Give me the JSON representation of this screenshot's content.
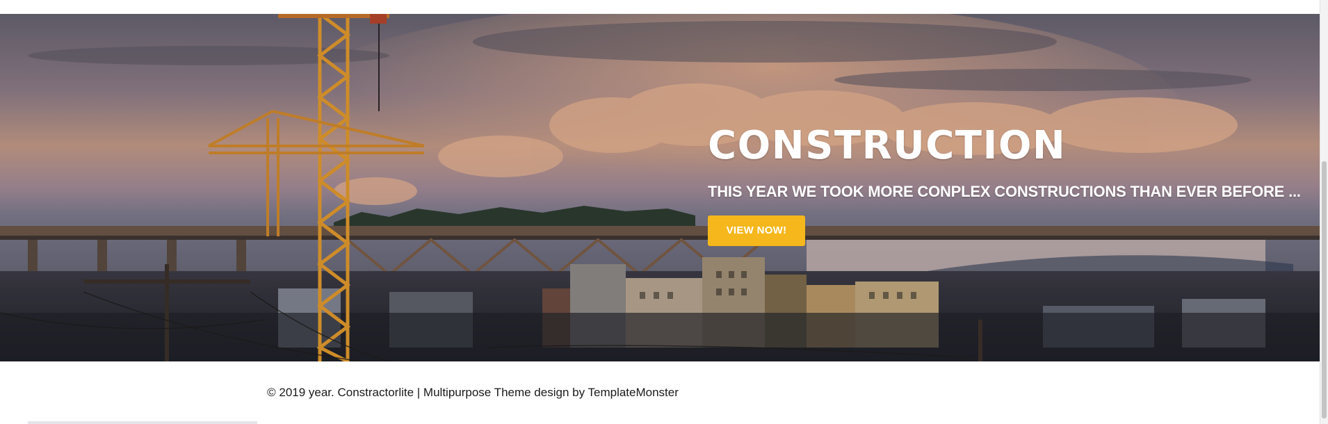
{
  "hero": {
    "title": "CONSTRUCTION",
    "subtitle": "THIS YEAR WE TOOK MORE CONPLEX CONSTRUCTIONS THAN EVER BEFORE ...",
    "button_label": "VIEW NOW!",
    "button_color": "#f5b71b"
  },
  "footer": {
    "copyright": "© 2019 year. Constractorlite | Multipurpose Theme design by TemplateMonster"
  }
}
